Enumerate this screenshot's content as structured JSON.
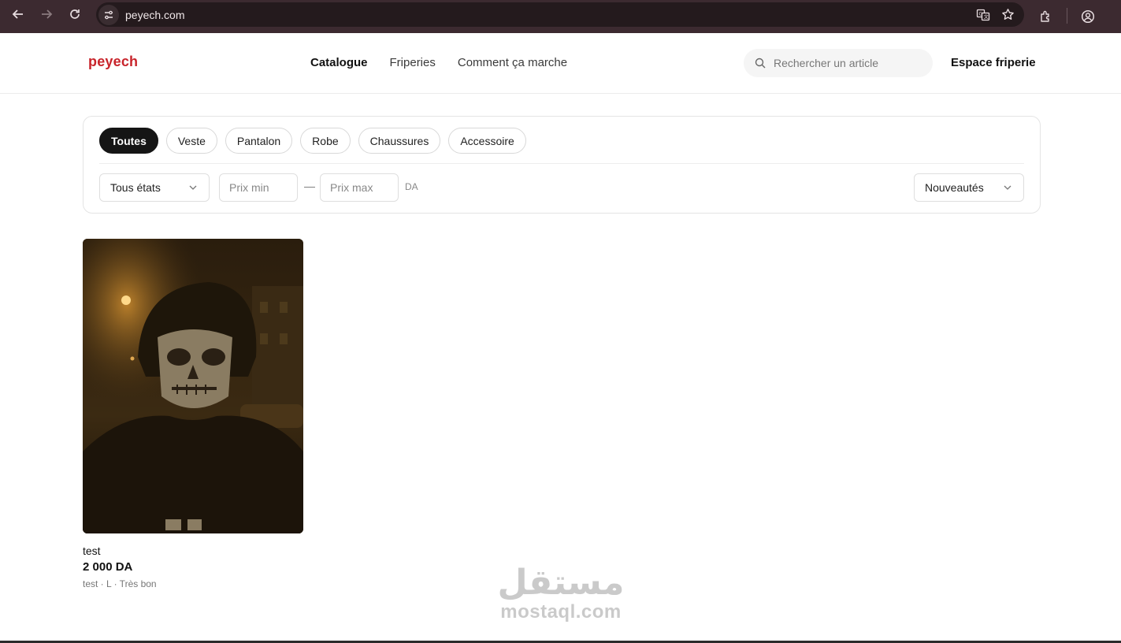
{
  "browser": {
    "url": "peyech.com",
    "icons": [
      "back-arrow-icon",
      "forward-arrow-icon",
      "reload-icon",
      "site-settings-icon",
      "translate-icon",
      "star-icon",
      "extensions-icon",
      "profile-icon"
    ]
  },
  "header": {
    "logo": "peyech",
    "nav": [
      {
        "label": "Catalogue",
        "active": true
      },
      {
        "label": "Friperies",
        "active": false
      },
      {
        "label": "Comment ça marche",
        "active": false
      }
    ],
    "search_placeholder": "Rechercher un article",
    "espace_label": "Espace friperie"
  },
  "filters": {
    "categories": [
      {
        "label": "Toutes",
        "active": true
      },
      {
        "label": "Veste",
        "active": false
      },
      {
        "label": "Pantalon",
        "active": false
      },
      {
        "label": "Robe",
        "active": false
      },
      {
        "label": "Chaussures",
        "active": false
      },
      {
        "label": "Accessoire",
        "active": false
      }
    ],
    "condition_select": "Tous états",
    "price_min_placeholder": "Prix min",
    "price_separator": "—",
    "price_max_placeholder": "Prix max",
    "currency": "DA",
    "sort_select": "Nouveautés"
  },
  "products": [
    {
      "title": "test",
      "price": "2 000 DA",
      "meta": "test · L · Très bon"
    }
  ],
  "watermark": {
    "arabic": "مستقل",
    "latin": "mostaql.com"
  },
  "colors": {
    "brand": "#c8242b",
    "chrome": "#3c2a30",
    "chip_active": "#151515"
  }
}
